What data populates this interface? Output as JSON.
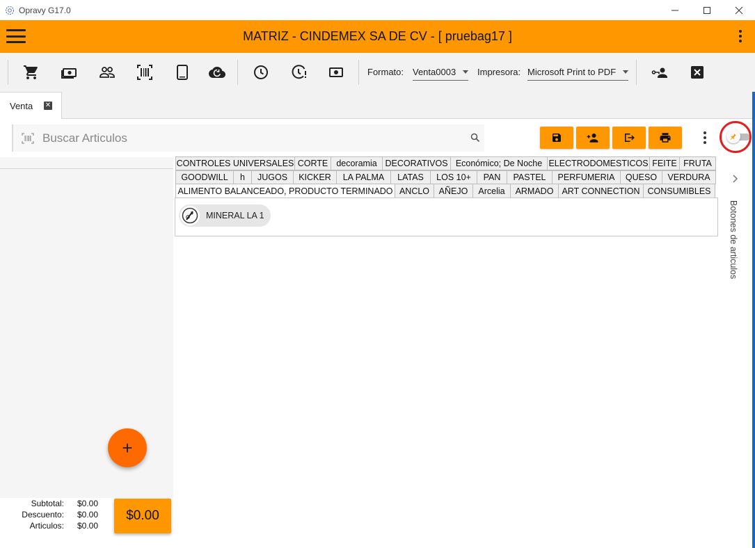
{
  "window": {
    "title": "Opravy G17.0",
    "app_icon": "gear-globe-icon",
    "controls": [
      "minimize-icon",
      "maximize-icon",
      "close-icon"
    ]
  },
  "appbar": {
    "title": "MATRIZ - CINDEMEX SA DE CV - [ pruebag17 ]",
    "accent": "#ff9800"
  },
  "toolbar": {
    "icons": [
      "cart-icon",
      "cash-icon",
      "people-icon",
      "barcode-icon",
      "tablet-icon",
      "cloud-sync-icon",
      "clock-icon",
      "clock-alert-icon",
      "money-icon",
      "user-key-icon",
      "close-box-icon"
    ],
    "formato_label": "Formato:",
    "formato_value": "Venta0003",
    "impresora_label": "Impresora:",
    "impresora_value": "Microsoft Print to PDF"
  },
  "doc_tabs": [
    {
      "label": "Venta",
      "active": true
    }
  ],
  "search": {
    "placeholder": "Buscar Articulos"
  },
  "actions": [
    "save-icon",
    "add-user-icon",
    "exit-icon",
    "print-icon"
  ],
  "categories": {
    "row1": [
      "CONTROLES UNIVERSALES",
      "CORTE",
      "decoramia",
      "DECORATIVOS",
      "Económico; De Noche",
      "ELECTRODOMESTICOS",
      "FEITE",
      "FRUTA"
    ],
    "row2": [
      "GOODWILL",
      "h",
      "JUGOS",
      "KICKER",
      "LA PALMA",
      "LATAS",
      "LOS 10+",
      "PAN",
      "PASTEL",
      "PERFUMERIA",
      "QUESO",
      "VERDURA"
    ],
    "row3": [
      "ALIMENTO BALANCEADO, PRODUCTO TERMINADO",
      "ANCLO",
      "AÑEJO",
      "Arcelia",
      "ARMADO",
      "ART CONNECTION",
      "CONSUMIBLES"
    ],
    "active": "ALIMENTO BALANCEADO, PRODUCTO TERMINADO",
    "items": [
      {
        "label": "MINERAL LA 1"
      }
    ]
  },
  "sidepanel": {
    "label": "Botones de articulos"
  },
  "totals": {
    "subtotal_label": "Subtotal:",
    "subtotal_value": "$0.00",
    "descuento_label": "Descuento:",
    "descuento_value": "$0.00",
    "articulos_label": "Articulos:",
    "articulos_value": "$0.00",
    "total_button": "$0.00"
  },
  "fab_label": "+"
}
